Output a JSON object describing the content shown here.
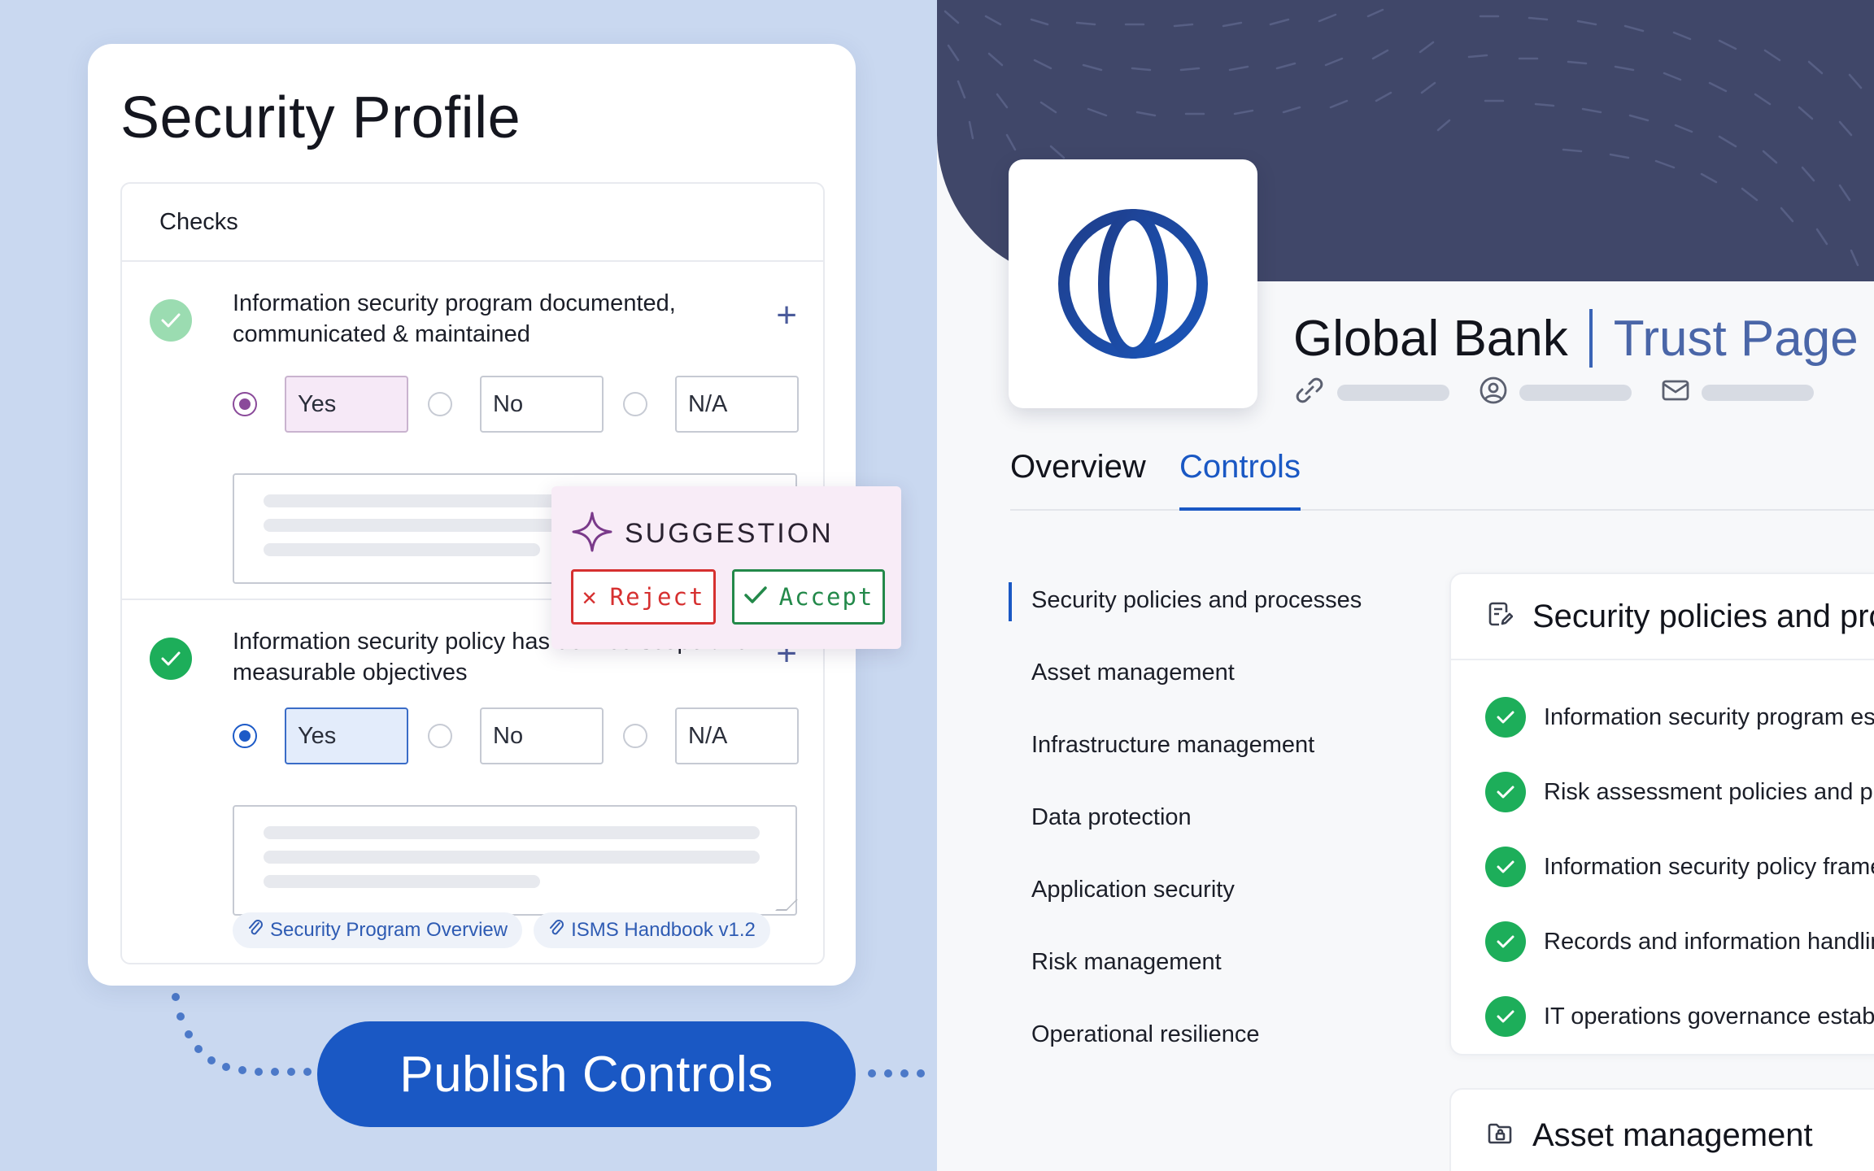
{
  "profile": {
    "title": "Security Profile",
    "checks_header": "Checks",
    "items": [
      {
        "text": "Information security program documented, communicated & maintained",
        "options": [
          "Yes",
          "No",
          "N/A"
        ],
        "selected": "Yes"
      },
      {
        "text": "Information security policy has defined scope and measurable objectives",
        "options": [
          "Yes",
          "No",
          "N/A"
        ],
        "selected": "Yes",
        "attachments": [
          "Security Program Overview",
          "ISMS Handbook v1.2"
        ]
      }
    ]
  },
  "suggestion": {
    "label": "SUGGESTION",
    "reject": "Reject",
    "accept": "Accept"
  },
  "publish_button": "Publish Controls",
  "trust_page": {
    "company": "Global Bank",
    "page_label": "Trust Page",
    "tabs": [
      "Overview",
      "Controls"
    ],
    "active_tab": "Controls",
    "categories": [
      "Security policies and processes",
      "Asset management",
      "Infrastructure management",
      "Data protection",
      "Application security",
      "Risk management",
      "Operational resilience"
    ],
    "active_category": "Security policies and processes",
    "section": {
      "title": "Security policies and processes",
      "controls": [
        "Information security program established",
        "Risk assessment policies and procedures",
        "Information security policy framework",
        "Records and information handling",
        "IT operations governance established"
      ]
    },
    "next_section": {
      "title": "Asset management"
    }
  },
  "colors": {
    "accent_blue": "#1a58c4",
    "banner": "#404769",
    "success_green": "#1dae5a",
    "suggestion_bg": "#f8ecf7",
    "reject_red": "#d63030",
    "accept_green": "#23894a"
  }
}
